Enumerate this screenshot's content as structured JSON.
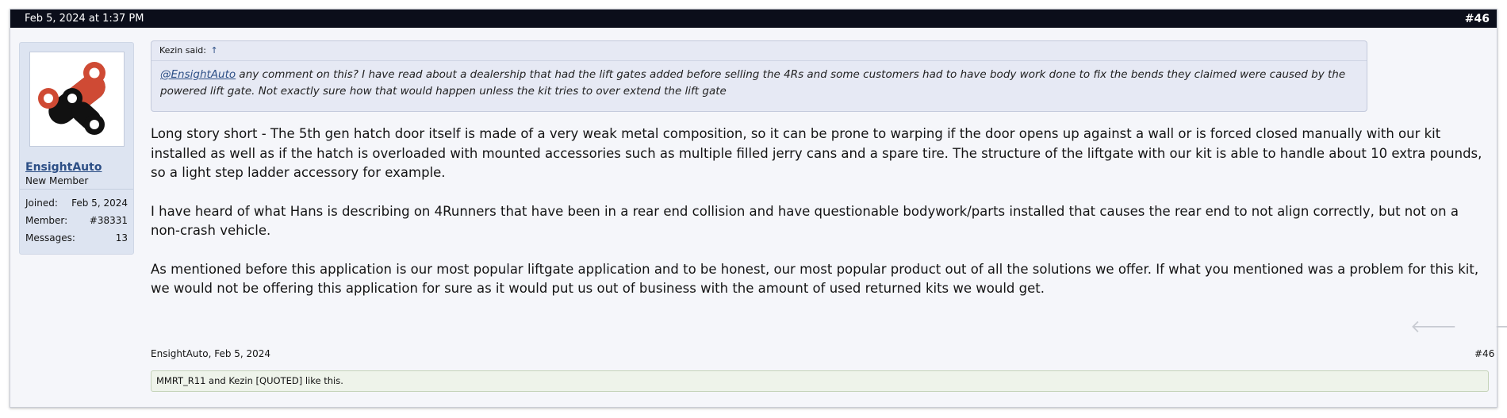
{
  "header": {
    "timestamp": "Feb 5, 2024 at 1:37 PM",
    "post_number": "#46"
  },
  "user": {
    "avatar_icon": "chain-link-logo-icon",
    "username": "EnsightAuto",
    "title": "New Member",
    "stats": [
      {
        "label": "Joined:",
        "value": "Feb 5, 2024"
      },
      {
        "label": "Member:",
        "value": "#38331"
      },
      {
        "label": "Messages:",
        "value": "13"
      }
    ]
  },
  "quote": {
    "author": "Kezin said:",
    "arrow": "↑",
    "mention": "@EnsightAuto",
    "text": " any comment on this? I have read about a dealership that had the lift gates added before selling the 4Rs and some customers had to have body work done to fix the bends they claimed were caused by the powered lift gate. Not exactly sure how that would happen unless the kit tries to over extend the lift gate"
  },
  "message": {
    "paragraphs": [
      "Long story short - The 5th gen hatch door itself is made of a very weak metal composition, so it can be prone to warping if the door opens up against a wall or is forced closed manually with our kit installed as well as if the hatch is overloaded with mounted accessories such as multiple filled jerry cans and a spare tire. The structure of the liftgate with our kit is able to handle about 10 extra pounds, so a light step ladder accessory for example.",
      "I have heard of what Hans is describing on 4Runners that have been in a rear end collision and have questionable bodywork/parts installed that causes the rear end to not align correctly, but not on a non-crash vehicle.",
      "As mentioned before this application is our most popular liftgate application and to be honest, our most popular product out of all the solutions we offer. If what you mentioned was a problem for this kit, we would not be offering this application for sure as it would put us out of business with the amount of used returned kits we would get."
    ]
  },
  "nav": {
    "prev": "🡐",
    "next": "🡒"
  },
  "footer": {
    "author_date": "EnsightAuto, Feb 5, 2024",
    "post_number": "#46"
  },
  "likes": {
    "text": "MMRT_R11 and Kezin [QUOTED] like this."
  },
  "colors": {
    "header_bg": "#0b0e1a",
    "user_panel_bg": "#dde4f1",
    "link": "#2d4f86",
    "avatar_red": "#cf4a34",
    "avatar_black": "#111111"
  }
}
